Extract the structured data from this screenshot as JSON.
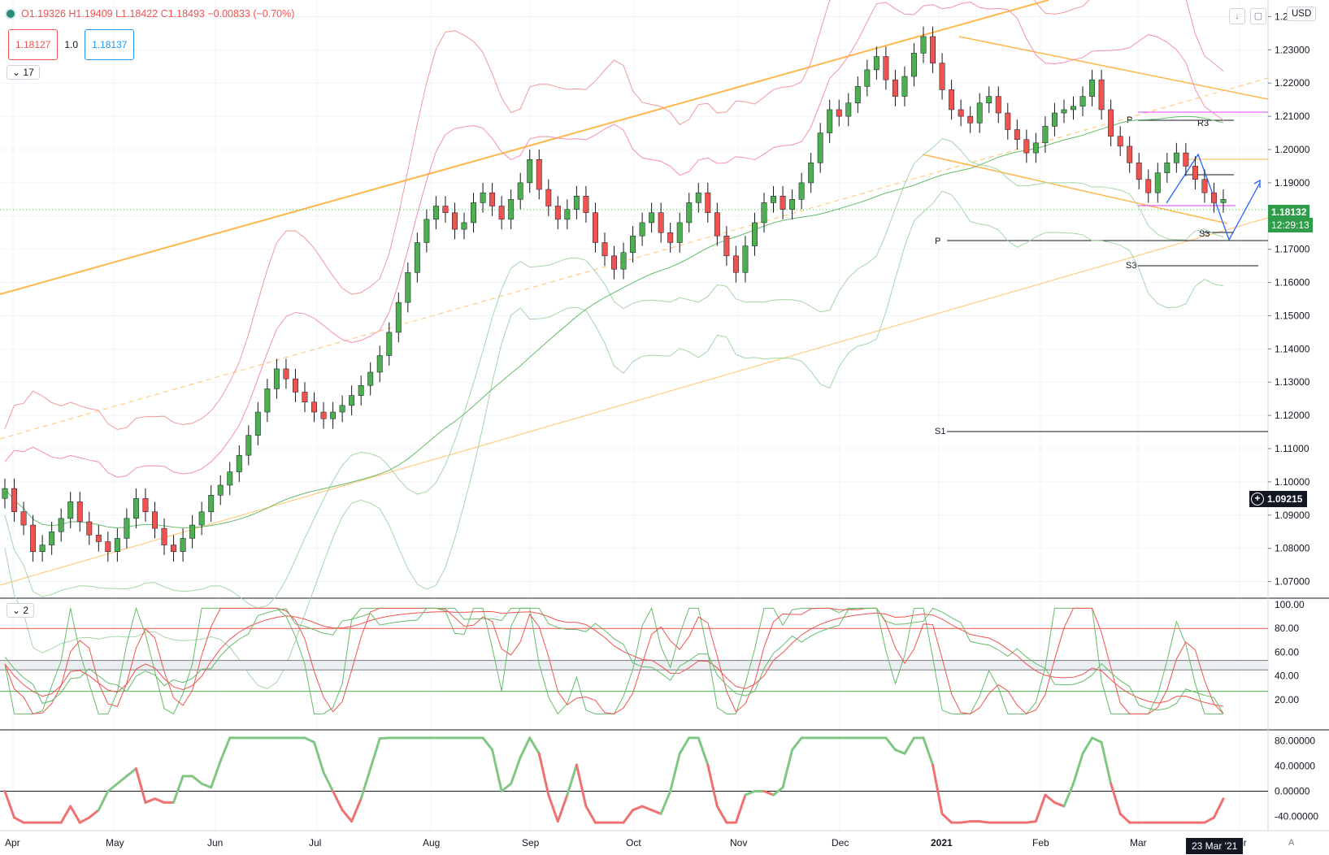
{
  "header": {
    "ohlc_text": "O1.19326 H1.19409 L1.18422 C1.18493 −0.00833 (−0.70%)",
    "sell_price": "1.18127",
    "quantity": "1.0",
    "buy_price": "1.18137",
    "indicator_count_main": "17",
    "indicator_count_osc": "2",
    "currency": "USD"
  },
  "price_axis": {
    "labels": [
      "1.24000",
      "1.23000",
      "1.22000",
      "1.21000",
      "1.20000",
      "1.19000",
      "1.18000",
      "1.17000",
      "1.16000",
      "1.15000",
      "1.14000",
      "1.13000",
      "1.12000",
      "1.11000",
      "1.10000",
      "1.09000",
      "1.08000",
      "1.07000"
    ],
    "last_price": "1.18132",
    "countdown": "12:29:13",
    "crosshair_price": "1.09215"
  },
  "osc_axis": {
    "labels": [
      "100.00",
      "80.00",
      "60.00",
      "40.00",
      "20.00"
    ]
  },
  "mom_axis": {
    "labels": [
      "80.00000",
      "40.00000",
      "0.00000",
      "-40.00000"
    ]
  },
  "time_axis": {
    "labels": [
      "Apr",
      "May",
      "Jun",
      "Jul",
      "Aug",
      "Sep",
      "Oct",
      "Nov",
      "Dec",
      "2021",
      "Feb",
      "Mar",
      "Apr"
    ],
    "crosshair_date": "23 Mar '21"
  },
  "pivot_labels": [
    "R3",
    "P",
    "P",
    "S3",
    "S3",
    "S1"
  ],
  "auto_scale": "A",
  "colors": {
    "up": "#4caf50",
    "down": "#ef5350",
    "trend": "#ffb74d",
    "bb": "#f48fb1"
  },
  "chart_data": {
    "type": "candlestick",
    "main": {
      "y_range": [
        1.065,
        1.245
      ],
      "close_series": [
        1.098,
        1.091,
        1.087,
        1.079,
        1.081,
        1.085,
        1.089,
        1.094,
        1.088,
        1.084,
        1.082,
        1.079,
        1.083,
        1.089,
        1.095,
        1.091,
        1.086,
        1.081,
        1.079,
        1.083,
        1.087,
        1.091,
        1.096,
        1.099,
        1.103,
        1.108,
        1.114,
        1.121,
        1.128,
        1.134,
        1.131,
        1.127,
        1.124,
        1.121,
        1.119,
        1.121,
        1.123,
        1.126,
        1.129,
        1.133,
        1.138,
        1.145,
        1.154,
        1.163,
        1.172,
        1.179,
        1.183,
        1.181,
        1.176,
        1.178,
        1.184,
        1.187,
        1.183,
        1.179,
        1.185,
        1.19,
        1.197,
        1.188,
        1.183,
        1.179,
        1.182,
        1.186,
        1.181,
        1.172,
        1.168,
        1.164,
        1.169,
        1.174,
        1.178,
        1.181,
        1.175,
        1.172,
        1.178,
        1.184,
        1.187,
        1.181,
        1.174,
        1.168,
        1.163,
        1.171,
        1.178,
        1.184,
        1.186,
        1.182,
        1.185,
        1.19,
        1.196,
        1.205,
        1.212,
        1.21,
        1.214,
        1.219,
        1.224,
        1.228,
        1.221,
        1.216,
        1.222,
        1.229,
        1.234,
        1.226,
        1.218,
        1.212,
        1.21,
        1.208,
        1.214,
        1.216,
        1.211,
        1.206,
        1.203,
        1.199,
        1.202,
        1.207,
        1.211,
        1.212,
        1.213,
        1.216,
        1.221,
        1.212,
        1.204,
        1.201,
        1.196,
        1.191,
        1.187,
        1.193,
        1.196,
        1.199,
        1.195,
        1.191,
        1.187,
        1.184,
        1.185
      ],
      "current_price": 1.18132
    },
    "oscillator": {
      "y_range": [
        0,
        100
      ],
      "levels": [
        80,
        53,
        45,
        27
      ]
    },
    "momentum": {
      "y_range": [
        -55,
        90
      ],
      "zero": 0
    }
  }
}
